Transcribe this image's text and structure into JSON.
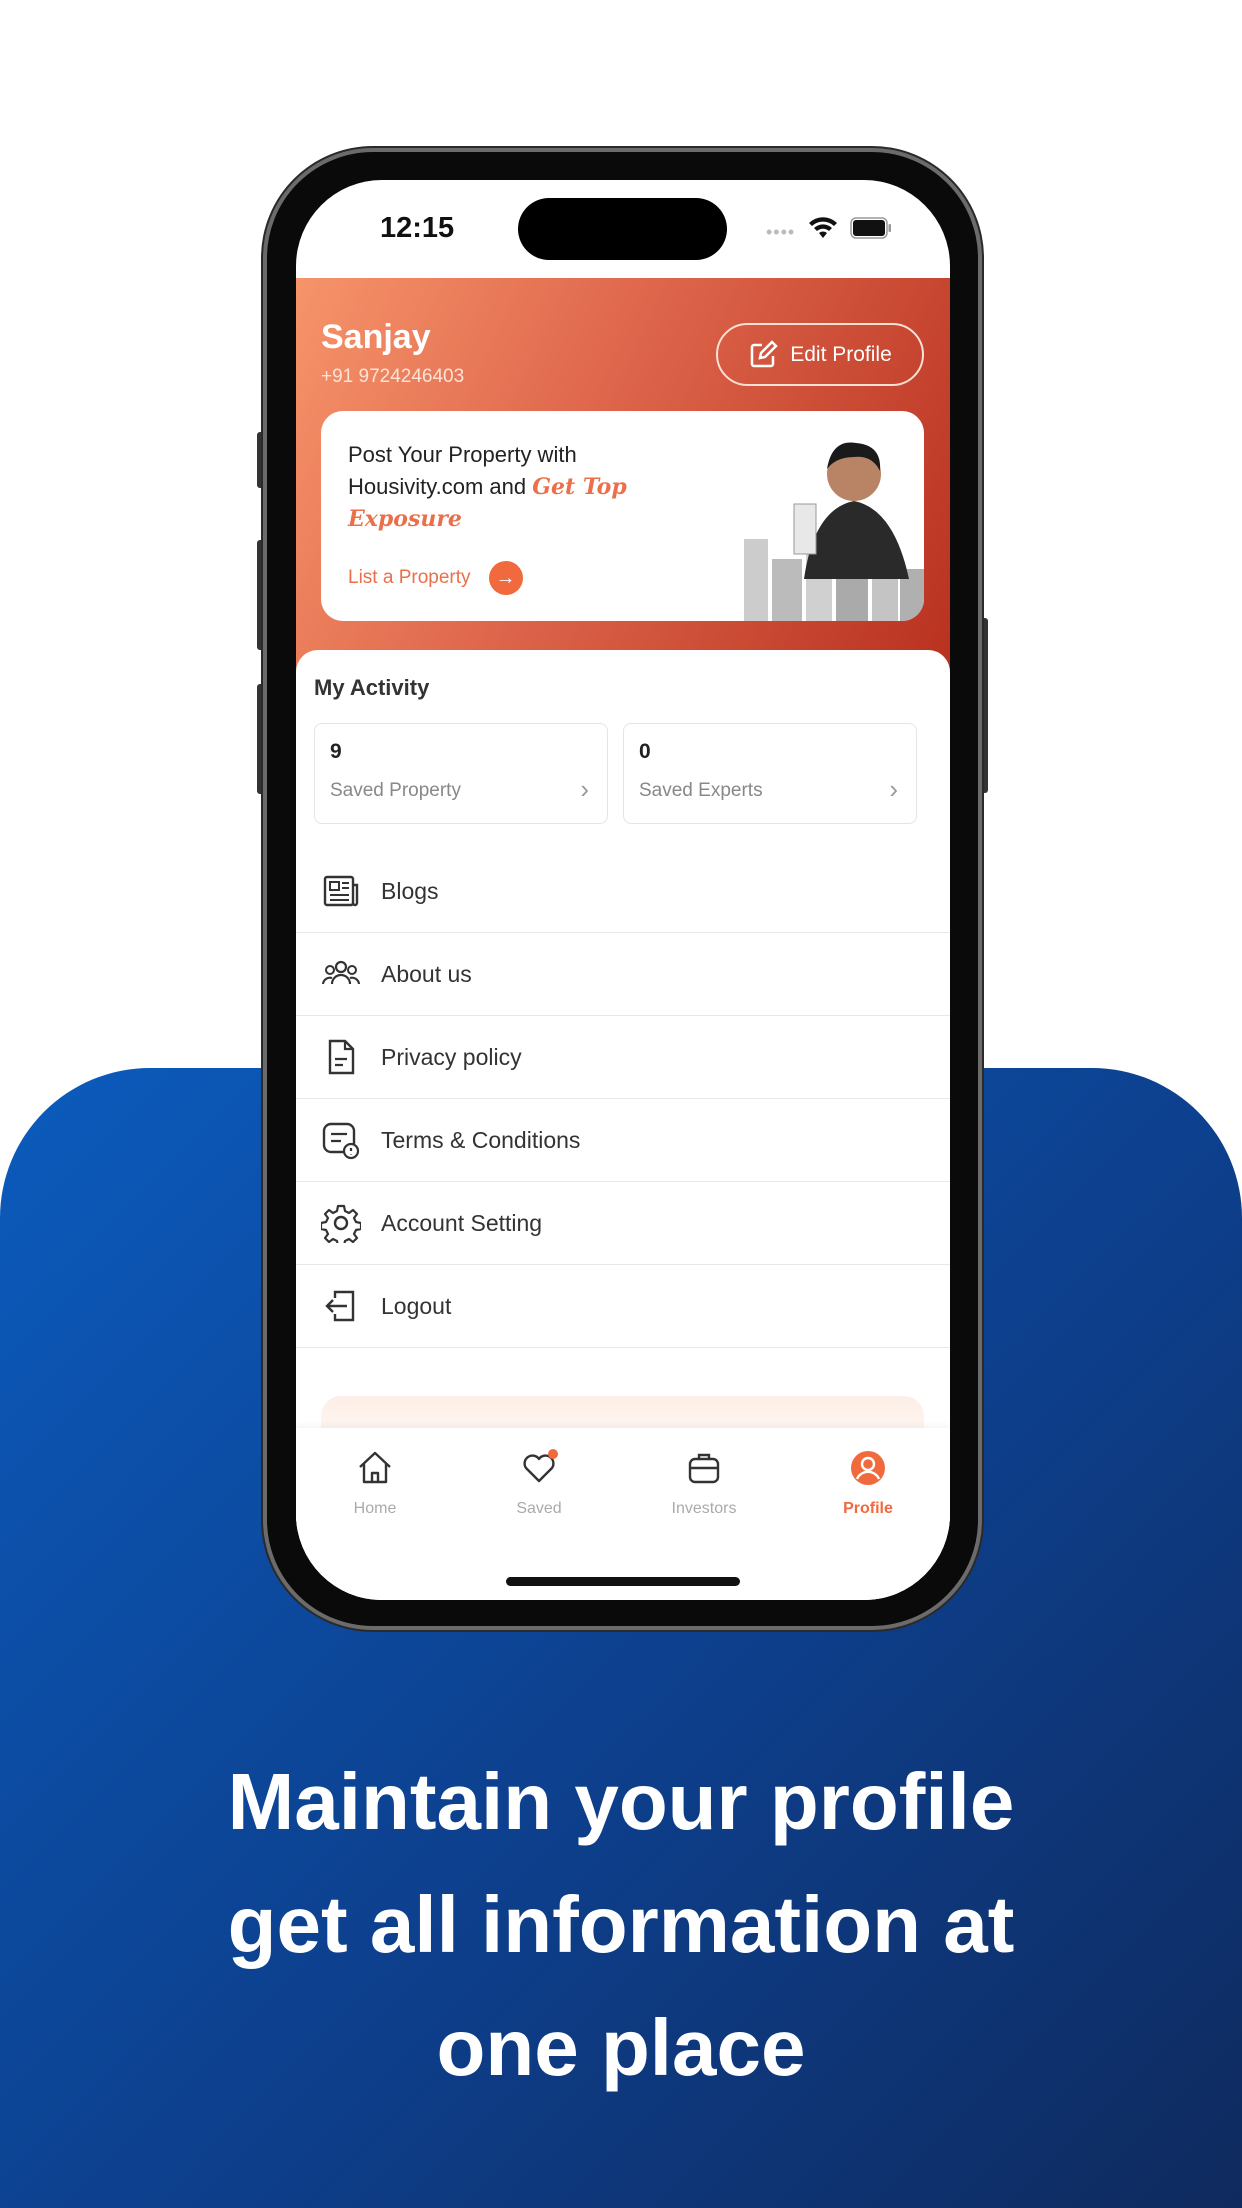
{
  "status_bar": {
    "time": "12:15"
  },
  "profile": {
    "name": "Sanjay",
    "phone": "+91 9724246403",
    "edit_label": "Edit Profile"
  },
  "promo": {
    "text": "Post Your Property with Housivity.com and ",
    "highlight": "Get Top Exposure",
    "cta": "List a Property"
  },
  "activity": {
    "title": "My Activity",
    "cards": [
      {
        "count": "9",
        "label": "Saved Property"
      },
      {
        "count": "0",
        "label": "Saved Experts"
      }
    ]
  },
  "menu": [
    {
      "label": "Blogs",
      "icon": "newspaper-icon"
    },
    {
      "label": "About us",
      "icon": "group-icon"
    },
    {
      "label": "Privacy policy",
      "icon": "document-icon"
    },
    {
      "label": "Terms & Conditions",
      "icon": "terms-icon"
    },
    {
      "label": "Account Setting",
      "icon": "gear-icon"
    },
    {
      "label": "Logout",
      "icon": "logout-icon"
    }
  ],
  "tabs": [
    {
      "label": "Home"
    },
    {
      "label": "Saved"
    },
    {
      "label": "Investors"
    },
    {
      "label": "Profile"
    }
  ],
  "colors": {
    "accent": "#f06a3d",
    "active_tab": "#f06a3d",
    "background_blue": "#0d3f8c"
  },
  "caption": {
    "line1": "Maintain your profile",
    "line2": "get all information at",
    "line3": "one place"
  }
}
